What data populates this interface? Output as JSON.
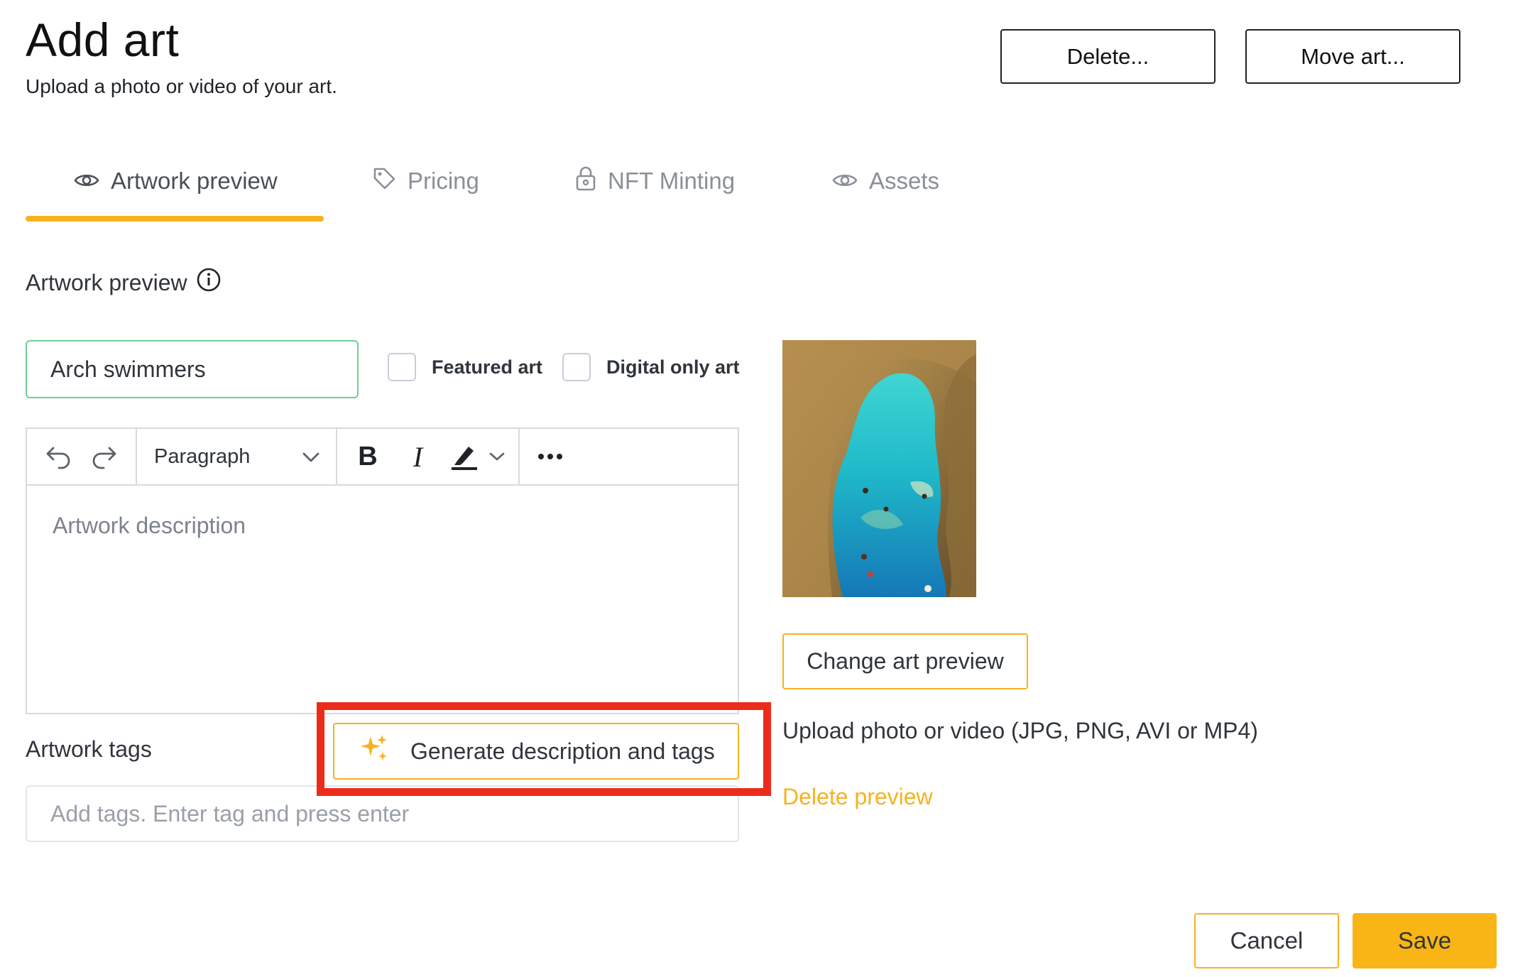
{
  "header": {
    "title": "Add art",
    "subtitle": "Upload a photo or video of your art.",
    "delete_label": "Delete...",
    "move_label": "Move art..."
  },
  "tabs": [
    {
      "label": "Artwork preview",
      "icon": "eye-icon",
      "active": true
    },
    {
      "label": "Pricing",
      "icon": "tag-icon",
      "active": false
    },
    {
      "label": "NFT Minting",
      "icon": "lock-icon",
      "active": false
    },
    {
      "label": "Assets",
      "icon": "eye-icon",
      "active": false
    }
  ],
  "section": {
    "label": "Artwork preview",
    "info_icon": "info-icon"
  },
  "form": {
    "title_value": "Arch swimmers",
    "featured_label": "Featured art",
    "featured_checked": false,
    "digital_label": "Digital only art",
    "digital_checked": false
  },
  "editor": {
    "block_format": "Paragraph",
    "placeholder": "Artwork description",
    "tools": [
      "undo-icon",
      "redo-icon",
      "bold-icon",
      "italic-icon",
      "highlight-icon",
      "more-icon"
    ]
  },
  "tags": {
    "label": "Artwork tags",
    "placeholder": "Add tags.  Enter tag and press enter",
    "generate_label": "Generate description and tags"
  },
  "preview": {
    "change_label": "Change art preview",
    "upload_hint": "Upload photo or video (JPG, PNG, AVI or MP4)",
    "delete_label": "Delete preview"
  },
  "footer": {
    "cancel_label": "Cancel",
    "save_label": "Save"
  },
  "colors": {
    "accent": "#F6B21E",
    "highlight_box": "#EC2C1A",
    "input_focus": "#6FCF97"
  }
}
